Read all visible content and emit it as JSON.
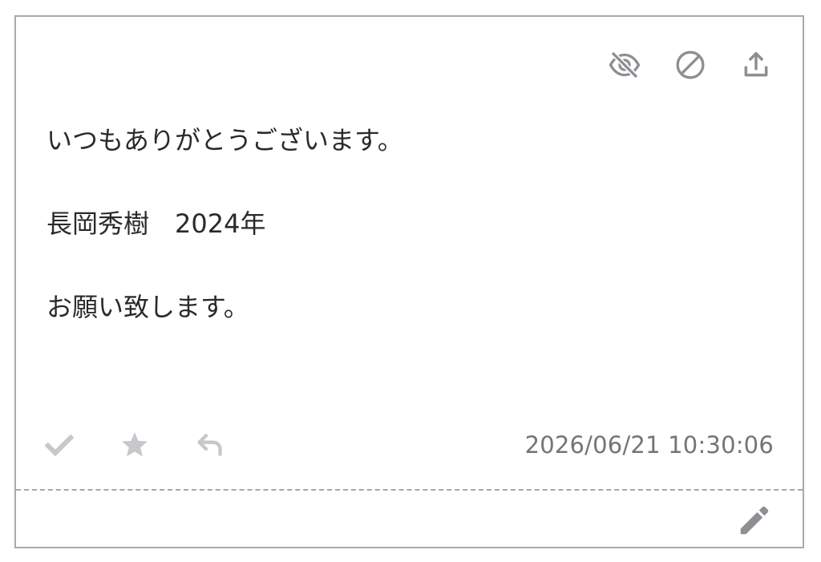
{
  "message": {
    "lines": [
      "いつもありがとうございます。",
      "長岡秀樹　2024年",
      "お願い致します。"
    ]
  },
  "footer": {
    "timestamp": "2026/06/21 10:30:06"
  },
  "icons": {
    "top": [
      "eye-off-icon",
      "block-icon",
      "upload-icon"
    ],
    "bottom": [
      "check-icon",
      "star-icon",
      "reply-icon"
    ],
    "edit": "pencil-icon"
  },
  "colors": {
    "border": "#a9a9ad",
    "icon_dark": "#8e8e93",
    "icon_light": "#c7c7cc",
    "text": "#2a2a2a",
    "timestamp": "#747479"
  }
}
